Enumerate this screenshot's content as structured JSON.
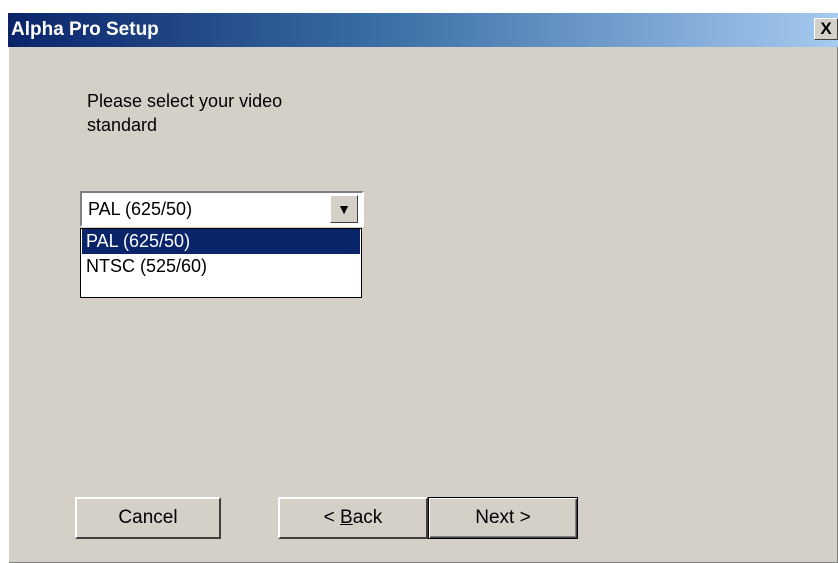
{
  "window": {
    "title": "Alpha Pro Setup",
    "close_label": "X"
  },
  "prompt": {
    "text": "Please select your video standard"
  },
  "video_standard": {
    "selected": "PAL (625/50)",
    "options": [
      "PAL (625/50)",
      "NTSC (525/60)"
    ],
    "highlighted_index": 0
  },
  "buttons": {
    "cancel": "Cancel",
    "back_prefix": "< ",
    "back_mnemonic": "B",
    "back_rest": "ack",
    "next": "Next >"
  },
  "colors": {
    "title_bar": "#0a246a",
    "dialog_face": "#d4d0c8",
    "selection": "#0a246a"
  },
  "icons": {
    "combo_arrow": "triangle-down-icon",
    "close": "close-icon"
  }
}
